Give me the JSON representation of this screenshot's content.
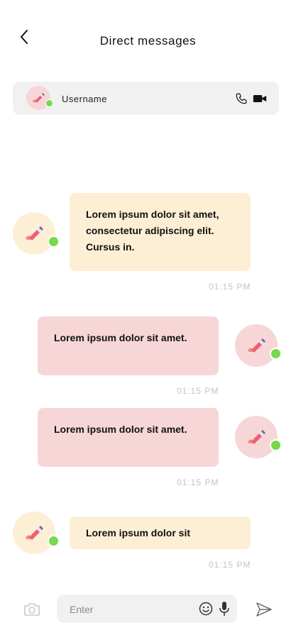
{
  "header": {
    "title": "Direct messages",
    "back_icon": "chevron-left-icon"
  },
  "contact": {
    "name": "Username",
    "status": "online",
    "call_icon": "phone-icon",
    "video_icon": "video-camera-icon"
  },
  "messages": [
    {
      "side": "left",
      "text_lines": [
        "Lorem ipsum dolor sit amet,",
        "consectetur adipiscing elit.",
        "Cursus in."
      ],
      "time": "01:15 PM",
      "color": "#fcefd6"
    },
    {
      "side": "right",
      "text_lines": [
        "Lorem ipsum dolor sit amet."
      ],
      "time": "01:15 PM",
      "color": "#f7d6d7"
    },
    {
      "side": "right",
      "text_lines": [
        "Lorem ipsum dolor sit amet."
      ],
      "time": "01:15 PM",
      "color": "#f7d6d7"
    },
    {
      "side": "left",
      "text_lines": [
        "Lorem ipsum dolor sit"
      ],
      "time": "01:15 PM",
      "color": "#fcefd6"
    }
  ],
  "composer": {
    "placeholder": "Enter",
    "value": "",
    "camera_icon": "camera-icon",
    "emoji_icon": "smiley-icon",
    "mic_icon": "microphone-icon",
    "send_icon": "send-icon"
  },
  "colors": {
    "online": "#76d84a",
    "incoming_bubble": "#fcefd6",
    "outgoing_bubble": "#f7d6d7",
    "timestamp": "#c3c3c3"
  }
}
